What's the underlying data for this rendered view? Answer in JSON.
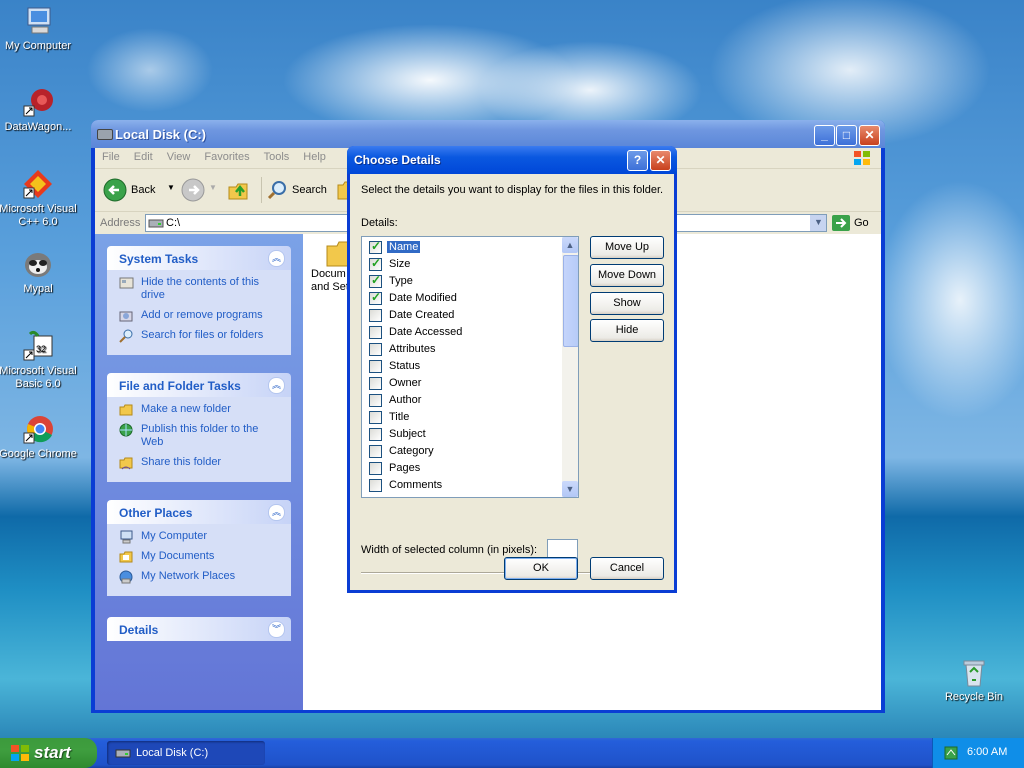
{
  "desktop": {
    "icons": [
      {
        "label": "My Computer",
        "icon": "my-computer-icon"
      },
      {
        "label": "DataWagon...",
        "icon": "datawagon-icon"
      },
      {
        "label": "Microsoft Visual C++ 6.0",
        "icon": "visual-cpp-icon"
      },
      {
        "label": "Mypal",
        "icon": "mypal-icon"
      },
      {
        "label": "Microsoft Visual Basic 6.0",
        "icon": "visual-basic-icon"
      },
      {
        "label": "Google Chrome",
        "icon": "chrome-icon"
      },
      {
        "label": "Recycle Bin",
        "icon": "recycle-bin-icon"
      }
    ]
  },
  "explorer": {
    "title": "Local Disk (C:)",
    "menu": [
      "File",
      "Edit",
      "View",
      "Favorites",
      "Tools",
      "Help"
    ],
    "toolbar": {
      "back": "Back",
      "search": "Search"
    },
    "address": {
      "label": "Address",
      "value": "C:\\",
      "go": "Go"
    },
    "panels": [
      {
        "title": "System Tasks",
        "tasks": [
          "Hide the contents of this drive",
          "Add or remove programs",
          "Search for files or folders"
        ]
      },
      {
        "title": "File and Folder Tasks",
        "tasks": [
          "Make a new folder",
          "Publish this folder to the Web",
          "Share this folder"
        ]
      },
      {
        "title": "Other Places",
        "tasks": [
          "My Computer",
          "My Documents",
          "My Network Places"
        ]
      },
      {
        "title": "Details",
        "tasks": []
      }
    ],
    "files": [
      {
        "name": "Docum and Set"
      }
    ]
  },
  "dialog": {
    "title": "Choose Details",
    "description": "Select the details you want to display for the files in this folder.",
    "details_label": "Details:",
    "items": [
      {
        "label": "Name",
        "checked": true,
        "selected": true
      },
      {
        "label": "Size",
        "checked": true
      },
      {
        "label": "Type",
        "checked": true
      },
      {
        "label": "Date Modified",
        "checked": true
      },
      {
        "label": "Date Created",
        "checked": false
      },
      {
        "label": "Date Accessed",
        "checked": false
      },
      {
        "label": "Attributes",
        "checked": false
      },
      {
        "label": "Status",
        "checked": false
      },
      {
        "label": "Owner",
        "checked": false
      },
      {
        "label": "Author",
        "checked": false
      },
      {
        "label": "Title",
        "checked": false
      },
      {
        "label": "Subject",
        "checked": false
      },
      {
        "label": "Category",
        "checked": false
      },
      {
        "label": "Pages",
        "checked": false
      },
      {
        "label": "Comments",
        "checked": false
      }
    ],
    "buttons": {
      "move_up": "Move Up",
      "move_down": "Move Down",
      "show": "Show",
      "hide": "Hide",
      "ok": "OK",
      "cancel": "Cancel"
    },
    "width_label": "Width of selected column (in pixels):",
    "width_value": ""
  },
  "taskbar": {
    "start": "start",
    "task": "Local Disk (C:)",
    "clock": "6:00 AM"
  },
  "colors": {
    "xp_blue": "#0a3dd4",
    "task_link": "#215dc6",
    "selection": "#316ac5",
    "start_green": "#3c9a3c"
  }
}
